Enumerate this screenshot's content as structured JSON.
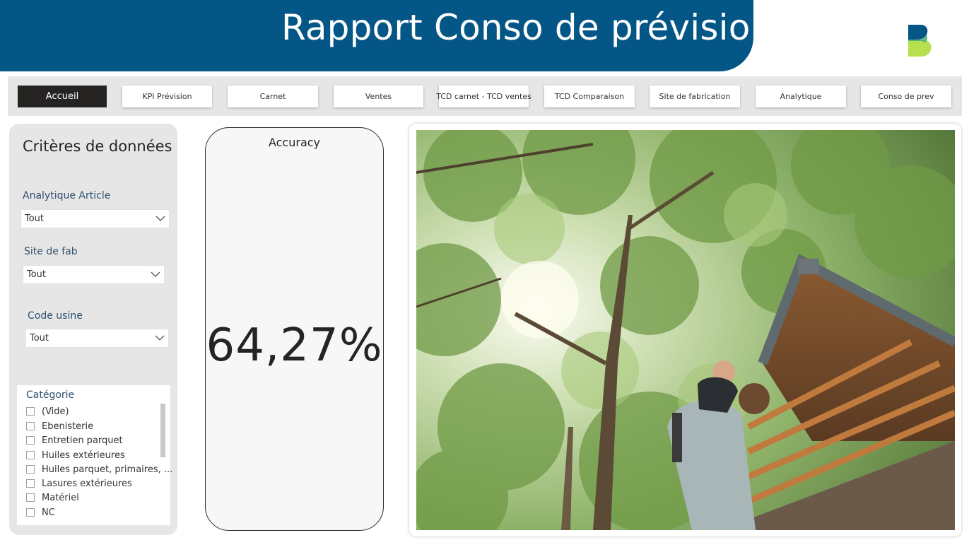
{
  "header": {
    "title": "Rapport Conso de prévision",
    "brand_color": "#035686",
    "logo_icon": "brand-b-logo"
  },
  "nav": {
    "buttons": [
      {
        "label": "Accueil",
        "active": true
      },
      {
        "label": "KPI Prévision"
      },
      {
        "label": "Carnet"
      },
      {
        "label": "Ventes"
      },
      {
        "label": "TCD carnet - TCD ventes"
      },
      {
        "label": "TCD Comparaison"
      },
      {
        "label": "Site de fabrication"
      },
      {
        "label": "Analytique"
      },
      {
        "label": "Conso de prev"
      }
    ]
  },
  "filters": {
    "title": "Critères de données",
    "analytique": {
      "label": "Analytique Article",
      "value": "Tout"
    },
    "site": {
      "label": "Site de fab",
      "value": "Tout"
    },
    "code_usine": {
      "label": "Code usine",
      "value": "Tout"
    },
    "categorie": {
      "label": "Catégorie",
      "items": [
        "(Vide)",
        "Ebenisterie",
        "Entretien parquet",
        "Huiles extérieures",
        "Huiles parquet, primaires, ...",
        "Lasures extérieures",
        "Matériel",
        "NC"
      ]
    }
  },
  "kpi": {
    "label": "Accuracy",
    "value": "64,27%"
  },
  "photo": {
    "icon": "treehouse-photo"
  }
}
